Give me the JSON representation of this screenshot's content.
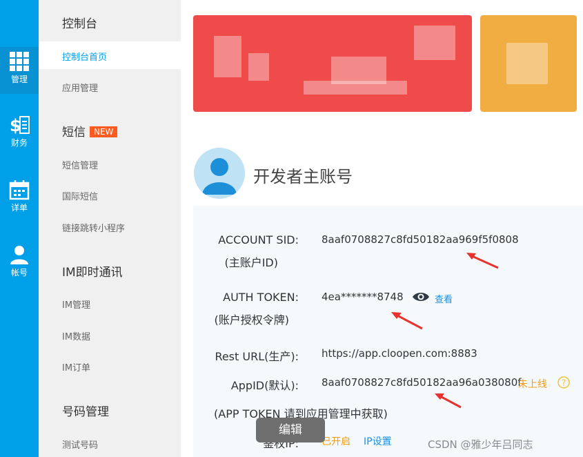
{
  "rail": {
    "items": [
      {
        "label": "管理",
        "icon": "grid-icon"
      },
      {
        "label": "财务",
        "icon": "finance-icon"
      },
      {
        "label": "详单",
        "icon": "calendar-icon"
      },
      {
        "label": "帐号",
        "icon": "user-icon"
      }
    ]
  },
  "subnav": {
    "console": "控制台",
    "console_home": "控制台首页",
    "app_manage": "应用管理",
    "sms": "短信",
    "new_badge": "NEW",
    "sms_manage": "短信管理",
    "intl_sms": "国际短信",
    "mini_program": "链接跳转小程序",
    "im": "IM即时通讯",
    "im_manage": "IM管理",
    "im_data": "IM数据",
    "im_order": "IM订单",
    "number_manage": "号码管理",
    "test_number": "测试号码"
  },
  "account": {
    "title": "开发者主账号",
    "sid_label": "ACCOUNT SID:",
    "sid_sub": "(主账户ID)",
    "sid_value": "8aaf0708827c8fd50182aa969f5f0808",
    "token_label": "AUTH TOKEN:",
    "token_sub": "(账户授权令牌)",
    "token_value": "4ea*******8748",
    "view_label": "查看",
    "rest_label": "Rest URL(生产):",
    "rest_value": "https://app.cloopen.com:8883",
    "appid_label": "AppID(默认):",
    "appid_value": "8aaf0708827c8fd50182aa96a038080f",
    "appid_status": "未上线",
    "app_token_note": "(APP TOKEN 请到应用管理中获取)",
    "auth_ip_label": "鉴权IP:",
    "auth_ip_status": "已开启",
    "ip_settings": "IP设置"
  },
  "overlay": {
    "edit": "编辑",
    "watermark": "CSDN @雅少年吕同志"
  },
  "colors": {
    "rail": "#00a0e9",
    "accent": "#1a8fe3",
    "banner_red": "#ef4b4b",
    "banner_orange": "#f0ad42",
    "arrow": "#e8322e"
  }
}
